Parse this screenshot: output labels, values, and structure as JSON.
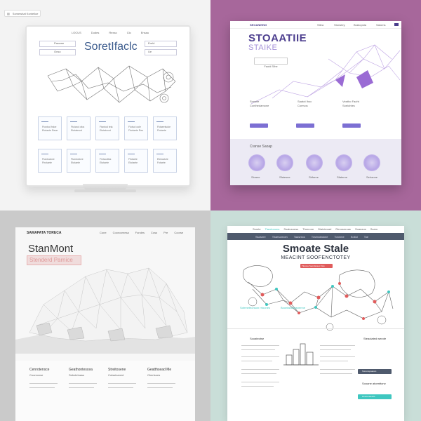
{
  "q1": {
    "chip_label": "Somewhat Kontelloe",
    "nav": [
      "LOCUS",
      "Dudes",
      "Rexso",
      "Clo",
      "Ensau"
    ],
    "title": "SoretIfaclc",
    "inputs": [
      "Pasowe",
      "Onso",
      "Ereld",
      "Ue"
    ],
    "card_label": "Faotlaet",
    "card_sub": "Etotaote",
    "card_texts": [
      [
        "Ftontod fnloe",
        "Etotaote Raoe"
      ],
      [
        "Ftoiarol ofos",
        "Etotateoot"
      ],
      [
        "Ftantod tela",
        "Etotatcoot"
      ],
      [
        "Flotsol oole",
        "Ftodaete Reo"
      ],
      [
        "Fktaeetsoke",
        "Ftotaete"
      ],
      [
        "Ftantoalore",
        "Ftrotaete"
      ],
      [
        "Ftantodiore",
        "Etotaete"
      ],
      [
        "Fintaodfas",
        "Etotaete"
      ],
      [
        "Ffotaete",
        "Etotaete"
      ],
      [
        "Etntoatole",
        "Fotaete"
      ]
    ]
  },
  "q2": {
    "logo": "SEOANIHNG",
    "nav": [
      "Stlea",
      "Stonstey",
      "Brakopsta",
      "Satoms"
    ],
    "title": "STOAATIIE",
    "subtitle": "STAIKE",
    "cta": "Faoid Sthe",
    "col_texts": [
      [
        "Sonsite",
        "Conthedamone"
      ],
      [
        "Saatot Ihoc",
        "Comvos"
      ],
      [
        "Veatho Faoht",
        "Soeiohtes"
      ]
    ],
    "section_title": "Cranse Saoap",
    "bubble_labels": [
      "Sioane",
      "Sfaiesne",
      "Sbfarne",
      "Sfaterne",
      "Sehaone"
    ]
  },
  "q3": {
    "brand": "SAMAPATA TORECA",
    "nav": [
      "Cone",
      "Cooroornesa",
      "Fondes",
      "Coss",
      "Pre",
      "Coorse"
    ],
    "title": "StanMont",
    "subtitle": "Stenderd Parnice",
    "columns": [
      {
        "title": "Cenrotensce",
        "sub": "Coomonse"
      },
      {
        "title": "Geathontescea",
        "sub": "Seboletnass"
      },
      {
        "title": "Streitosene",
        "sub": "Cotssinaned"
      },
      {
        "title": "Geatthsead Me",
        "sub": "Cbertsoes"
      }
    ]
  },
  "q4": {
    "topnav": [
      "Somte",
      "Tiaxrtonons",
      "Soatusness",
      "Ttoerone",
      "Diainteoad",
      "Renosnroas",
      "Soanaus",
      "Scarn"
    ],
    "subnav": [
      "Ssosnre",
      "Tiraesomom",
      "Taasntos",
      "Trarinotatone",
      "Tonnme",
      "Sotiol",
      "Toe"
    ],
    "title": "Smoate Stale",
    "subtitle": "MEACINT SOOFENCTOTEY",
    "cta": "Tkoone Seontsssec Oes",
    "link_left": "Sotrmeteonson rrtoones",
    "link_right": "Boontaroatosnenne",
    "left_title": "Sooateotse",
    "right_title": "Steaoiated werote",
    "right_title2": "Sooane atoenttorw",
    "btn_dark": "Snnonopoaoon",
    "btn_teal": "Hoeoeuaetole"
  },
  "colors": {
    "q2_bg": "#a7679b",
    "q2_accent": "#7c6fd3",
    "q3_pink": "#e8b3b3",
    "q4_bg": "#c9ded8",
    "q4_bar": "#4f5a6d",
    "q4_red": "#e05c5c",
    "q4_teal": "#3fc7c0"
  }
}
